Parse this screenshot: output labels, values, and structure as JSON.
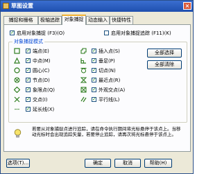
{
  "window": {
    "title": "草图设置",
    "close_symbol": "×"
  },
  "tabs": [
    {
      "label": "捕捉和栅格"
    },
    {
      "label": "极轴追踪"
    },
    {
      "label": "对象捕捉"
    },
    {
      "label": "动态输入"
    },
    {
      "label": "快捷特性"
    }
  ],
  "active_tab": "对象捕捉",
  "top_options": {
    "enable_osnap": {
      "label": "启用对象捕捉 (F3)(O)",
      "checked": true
    },
    "enable_tracking": {
      "label": "启用对象捕捉追踪 (F11)(K)",
      "checked": false
    }
  },
  "group": {
    "title": "对象捕捉模式"
  },
  "check_mark": "✓",
  "modes_left": [
    {
      "label": "端点(E)",
      "checked": true,
      "icon": "square-endpoint-icon"
    },
    {
      "label": "中点(M)",
      "checked": true,
      "icon": "triangle-midpoint-icon"
    },
    {
      "label": "圆心(C)",
      "checked": true,
      "icon": "circle-center-icon"
    },
    {
      "label": "节点(D)",
      "checked": true,
      "icon": "node-icon"
    },
    {
      "label": "象限点(Q)",
      "checked": true,
      "icon": "diamond-quadrant-icon"
    },
    {
      "label": "交点(I)",
      "checked": true,
      "icon": "x-intersection-icon"
    },
    {
      "label": "延长线(X)",
      "checked": true,
      "icon": "extension-dots-icon"
    }
  ],
  "modes_right": [
    {
      "label": "插入点(S)",
      "checked": true,
      "icon": "insert-icon"
    },
    {
      "label": "垂足(P)",
      "checked": true,
      "icon": "perpendicular-icon"
    },
    {
      "label": "切点(N)",
      "checked": true,
      "icon": "tangent-icon"
    },
    {
      "label": "最近点(R)",
      "checked": true,
      "icon": "nearest-icon"
    },
    {
      "label": "外观交点(A)",
      "checked": true,
      "icon": "apparent-intersection-icon"
    },
    {
      "label": "平行线(L)",
      "checked": true,
      "icon": "parallel-icon"
    }
  ],
  "buttons": {
    "select_all": "全部选择",
    "clear_all": "全部清除"
  },
  "info_text": "若要从对象捕捉点进行追踪，请在命令执行期间将光标悬停于该点上。当移动光标时会出现追踪矢量，若要停止追踪，请再次将光标悬停于该点上。",
  "footer": {
    "options": "选项(T)...",
    "ok": "确定",
    "cancel": "取消",
    "help": "帮助(H)"
  },
  "colors": {
    "titlebar": "#2a5cc4",
    "accent_symbol": "#2e7d1f",
    "group_title": "#0046d5"
  }
}
